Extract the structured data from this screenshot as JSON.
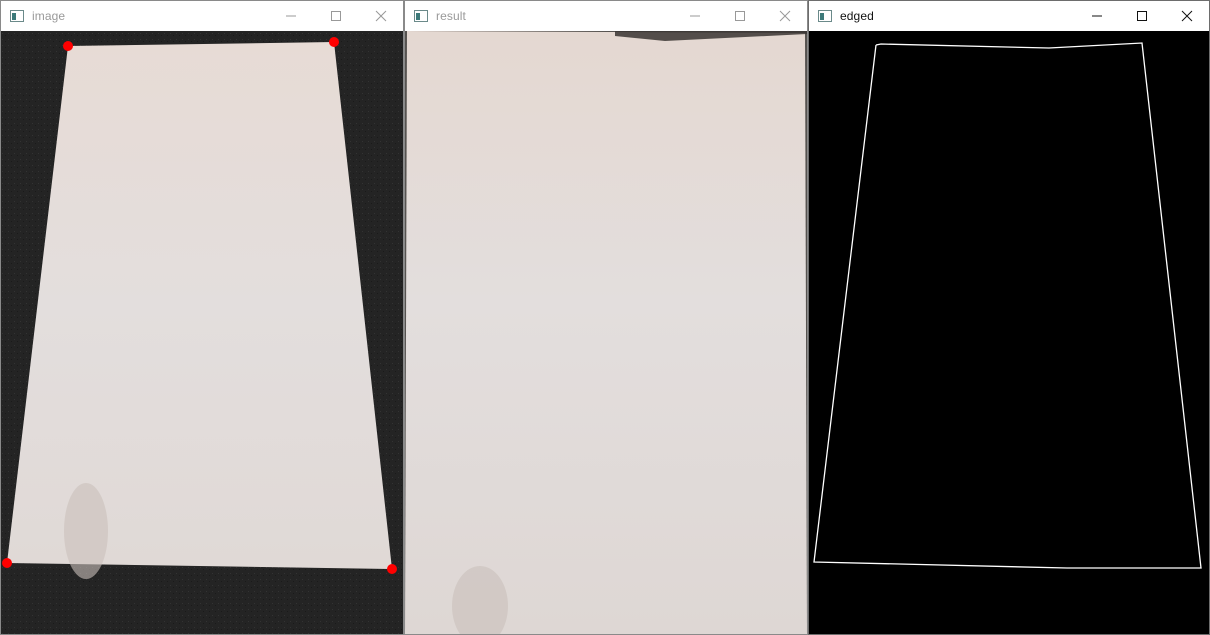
{
  "windows": [
    {
      "title": "image"
    },
    {
      "title": "result"
    },
    {
      "title": "edged"
    }
  ],
  "icons": {
    "app": "app-window-icon",
    "minimize": "minimize-icon",
    "maximize": "maximize-icon",
    "close": "close-icon"
  },
  "colors": {
    "corner_marker": "#ff0000",
    "edge_outline": "#ffffff",
    "paper": "#e6dcd8",
    "background_dark": "#262626",
    "edged_background": "#000000"
  },
  "detected_corners_count": 4
}
